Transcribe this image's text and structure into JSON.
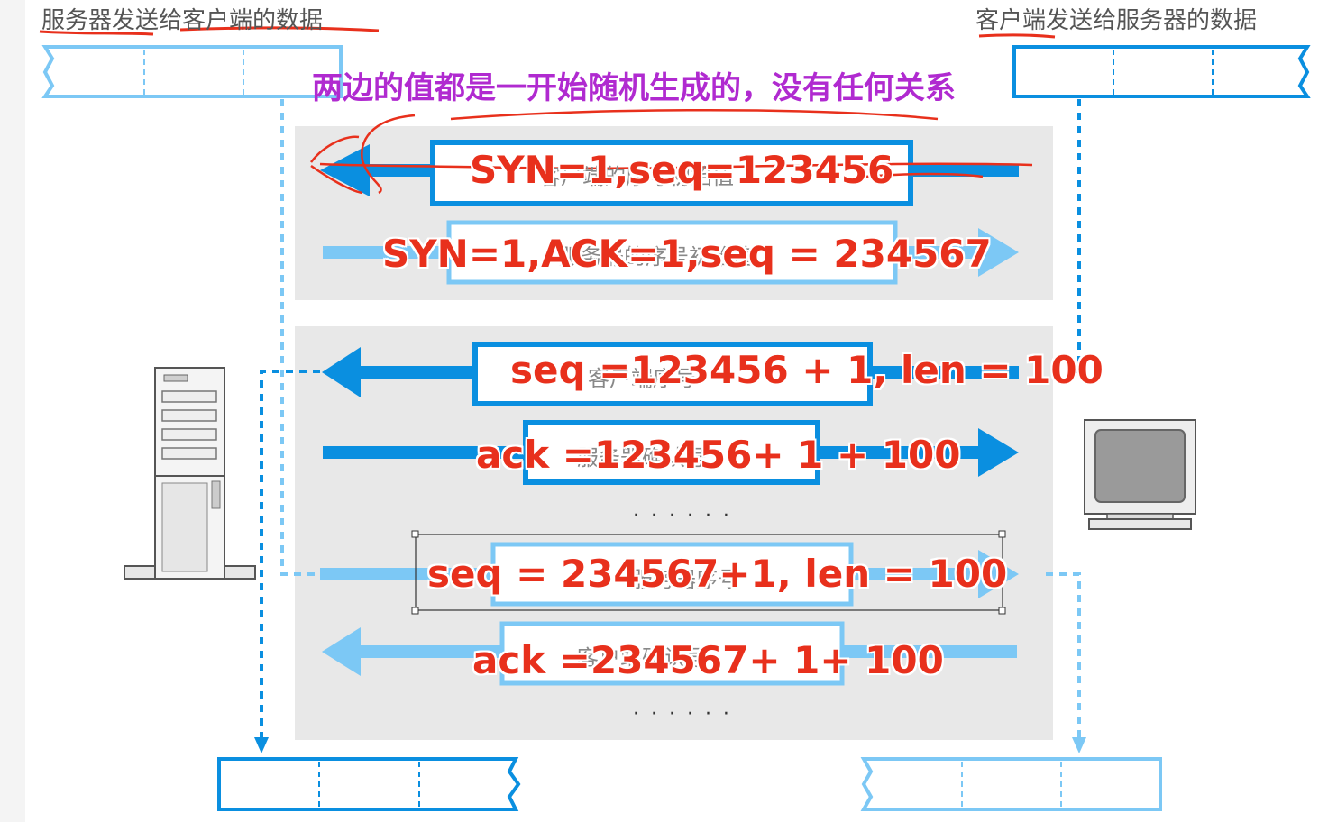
{
  "labels": {
    "server_data": "服务器发送给客户端的数据",
    "client_data": "客户端发送给服务器的数据",
    "headline": "两边的值都是一开始随机生成的，没有任何关系"
  },
  "handshake": {
    "msg1": "SYN=1,seq=123456",
    "msg1_under": "客户端的序号初始值",
    "msg2": "SYN=1,ACK=1,seq = 234567",
    "msg2_under": "服务器的序号初始值"
  },
  "transfer": {
    "msg3": "seq =123456 + 1, len = 100",
    "msg3_under": "客户端序号",
    "msg4": "ack =123456+ 1 + 100",
    "msg4_under": "服务器确认号",
    "dots1": "· · · · · ·",
    "msg5": "seq = 234567+1, len = 100",
    "msg5_under": "服务器序号",
    "msg6": "ack =234567+ 1+ 100",
    "msg6_under": "客户端确认号",
    "dots2": "· · · · · ·"
  },
  "colors": {
    "strong_blue": "#0a8fe0",
    "light_blue": "#7cc8f5",
    "annotation": "#e8301c",
    "headline": "#b02ad0"
  },
  "icons": [
    "server-icon",
    "computer-monitor-icon"
  ]
}
